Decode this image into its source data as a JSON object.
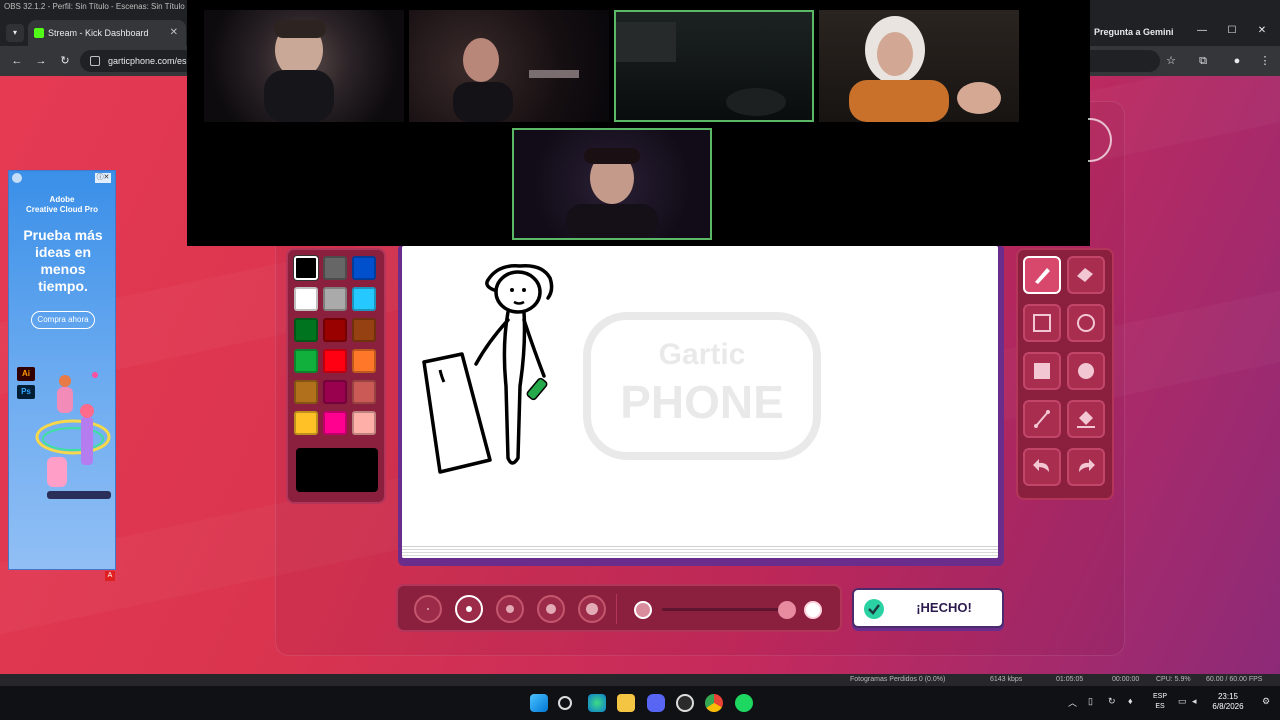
{
  "obs": {
    "title": "OBS 32.1.2 - Perfil: Sin Título - Escenas: Sin Título",
    "status_dropped": "Fotogramas Perdidos 0 (0.0%)",
    "status_bitrate": "6143 kbps",
    "status_time": "01:05:05",
    "status_rec": "00:00:00",
    "status_cpu": "CPU: 5.9%",
    "status_fps": "60.00 / 60.00 FPS"
  },
  "browser": {
    "tab_title": "Stream - Kick Dashboard",
    "url": "garticphone.com/es",
    "gemini_button": "Pregunta a Gemini",
    "icons": [
      "back-icon",
      "reload-icon",
      "star-icon",
      "extensions-icon",
      "profile-icon",
      "menu-icon"
    ]
  },
  "ad": {
    "brand_line1": "Adobe",
    "brand_line2": "Creative Cloud Pro",
    "headline": "Prueba más ideas en menos tiempo.",
    "cta": "Compra ahora",
    "ai_badge": "Ai",
    "ps_badge": "Ps",
    "choices_badge": "A"
  },
  "game": {
    "colors": [
      "#000000",
      "#666666",
      "#0050cd",
      "#ffffff",
      "#aaaaaa",
      "#26c9ff",
      "#017420",
      "#990000",
      "#964112",
      "#11b03c",
      "#ff0013",
      "#ff7829",
      "#b0701c",
      "#99004e",
      "#cb5a57",
      "#ffc126",
      "#ff008f",
      "#feafa8"
    ],
    "selected_color": "#000000",
    "tools": [
      "pen-icon",
      "eraser-icon",
      "square-outline-icon",
      "circle-outline-icon",
      "square-fill-icon",
      "circle-fill-icon",
      "line-icon",
      "bucket-icon",
      "undo-icon",
      "redo-icon"
    ],
    "active_tool": "pen-icon",
    "brush_sizes": 5,
    "active_size": 2,
    "done_label": "¡HECHO!",
    "watermark_top": "Gartic",
    "watermark_bottom": "PHONE"
  },
  "taskbar": {
    "lang_line1": "ESP",
    "lang_line2": "ES",
    "time": "23:15",
    "date": "6/8/2026"
  }
}
